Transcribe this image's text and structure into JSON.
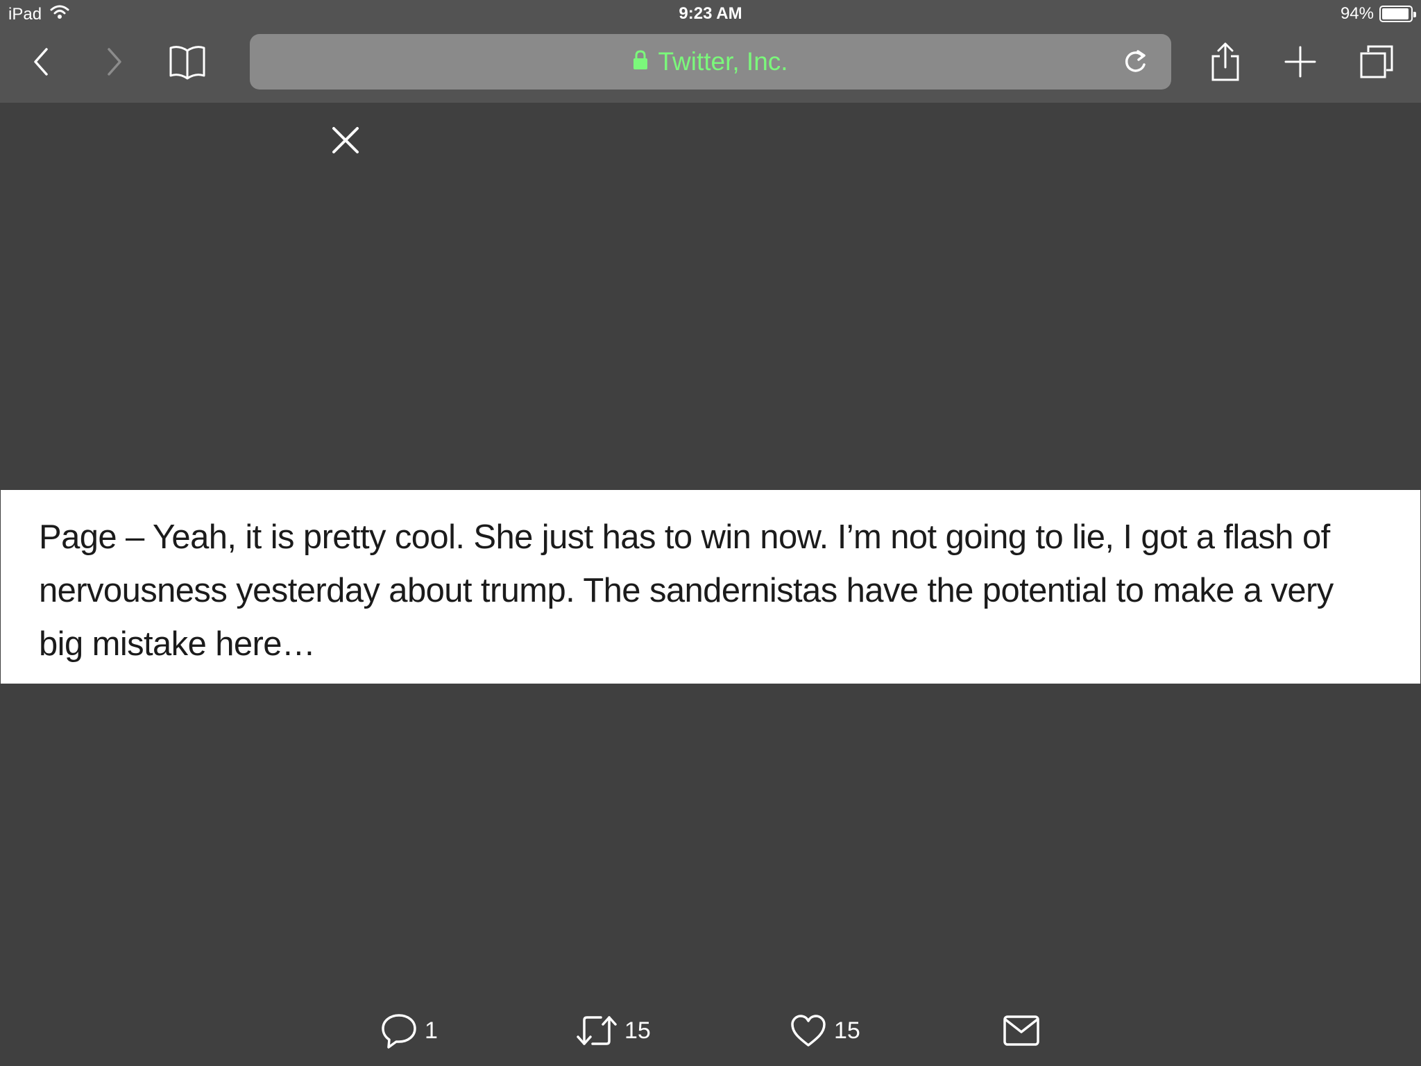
{
  "status_bar": {
    "device": "iPad",
    "time": "9:23 AM",
    "battery": "94%",
    "battery_level": 0.94
  },
  "toolbar": {
    "address_title": "Twitter, Inc.",
    "accent_color": "#7bf87b",
    "icons": [
      "back-icon",
      "forward-icon",
      "bookmarks-icon",
      "lock-icon",
      "reload-icon",
      "share-icon",
      "add-tab-icon",
      "tabs-icon"
    ]
  },
  "quote": {
    "text": "Page – Yeah, it is pretty cool. She just has to win now. I’m not going to lie, I got a flash of nervousness yesterday about trump. The sandernistas have the potential to make a very big mistake here…"
  },
  "actions": {
    "reply_count": "1",
    "retweet_count": "15",
    "like_count": "15"
  }
}
